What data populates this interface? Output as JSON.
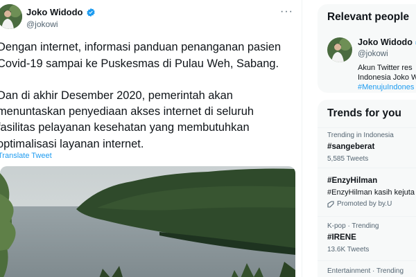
{
  "tweet": {
    "author_name": "Joko Widodo",
    "author_handle": "@jokowi",
    "more_icon": "more-horizontal-icon",
    "body_lines": [
      "Dengan internet, informasi panduan penanganan pasien",
      "Covid-19 sampai ke Puskesmas di Pulau Weh, Sabang.",
      "Dan di akhir Desember 2020, pemerintah akan",
      "menuntaskan penyediaan akses internet di seluruh",
      "fasilitas pelayanan kesehatan yang membutuhkan",
      "optimalisasi layanan internet."
    ],
    "translate_label": "Translate Tweet",
    "media_icon": "coastal-landscape-photo"
  },
  "relevant_people": {
    "title": "Relevant people",
    "name": "Joko Widodo",
    "handle": "@jokowi",
    "bio_lines": [
      "Akun Twitter res",
      "Indonesia Joko W"
    ],
    "bio_hashtag": "#MenujuIndones"
  },
  "trends": {
    "title": "Trends for you",
    "items": [
      {
        "meta": "Trending in Indonesia",
        "name": "#sangeberat",
        "count": "5,585 Tweets"
      },
      {
        "name": "#EnzyHilman",
        "desc": "#EnzyHilman kasih kejuta",
        "promo": "Promoted by by.U"
      },
      {
        "meta": "K-pop · Trending",
        "name": "#IRENE",
        "count": "13.6K Tweets"
      },
      {
        "meta": "Entertainment · Trending"
      }
    ]
  },
  "colors": {
    "accent": "#1d9bf0",
    "text": "#0f1419",
    "muted": "#536471",
    "card": "#f7f9f9"
  }
}
